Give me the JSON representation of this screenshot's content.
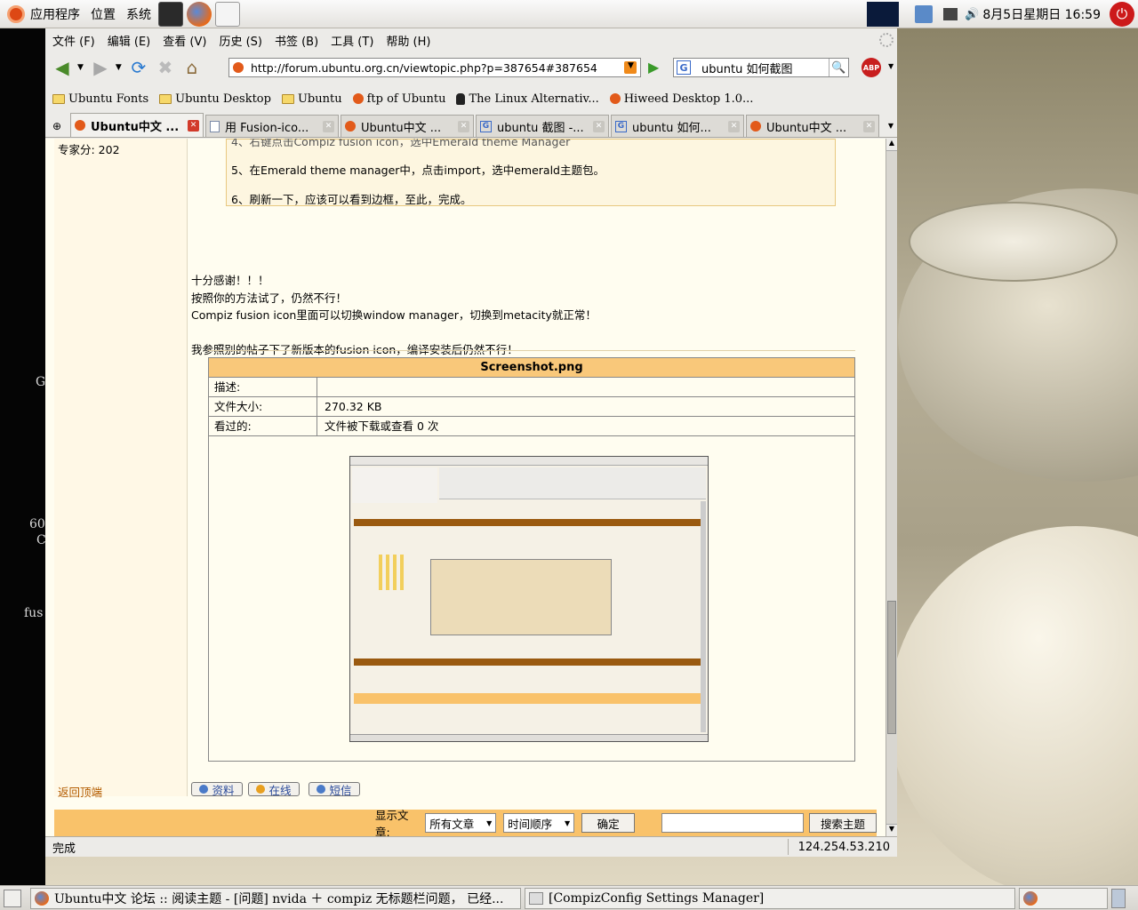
{
  "top_panel": {
    "menus": [
      "应用程序",
      "位置",
      "系统"
    ],
    "clock": "8月5日星期日 16:59"
  },
  "desktop": {
    "texts": [
      "G",
      "60",
      "C",
      "fus"
    ]
  },
  "browser": {
    "menubar": [
      "文件 (F)",
      "编辑 (E)",
      "查看 (V)",
      "历史 (S)",
      "书签 (B)",
      "工具 (T)",
      "帮助 (H)"
    ],
    "url": "http://forum.ubuntu.org.cn/viewtopic.php?p=387654#387654",
    "search_engine": "G",
    "search_value": "ubuntu 如何截图",
    "bookmarks": [
      "Ubuntu Fonts",
      "Ubuntu Desktop",
      "Ubuntu",
      "ftp of Ubuntu",
      "The Linux Alternativ...",
      "Hiweed Desktop 1.0..."
    ],
    "tabs": [
      "Ubuntu中文 ...",
      "用 Fusion-ico...",
      "Ubuntu中文 ...",
      "ubuntu 截图 -...",
      "ubuntu 如何...",
      "Ubuntu中文 ..."
    ],
    "status_left": "完成",
    "status_right": "124.254.53.210"
  },
  "post": {
    "expert_score": "专家分: 202",
    "quote_lines": [
      "4、右键点击Compiz fusion icon，选中Emerald theme Manager",
      "5、在Emerald theme manager中，点击import，选中emerald主题包。",
      "6、刷新一下，应该可以看到边框，至此，完成。"
    ],
    "body_lines": [
      "十分感谢！！！",
      "按照你的方法试了，仍然不行！",
      "Compiz fusion icon里面可以切换window manager，切换到metacity就正常！",
      "",
      "我参照别的帖子下了新版本的fusion icon，编译安装后仍然不行！"
    ],
    "attachment": {
      "title": "Screenshot.png",
      "rows": [
        {
          "label": "描述:",
          "value": ""
        },
        {
          "label": "文件大小:",
          "value": "270.32 KB"
        },
        {
          "label": "看过的:",
          "value": "文件被下载或查看 0 次"
        }
      ]
    },
    "back_to_top": "返回顶端",
    "action_buttons": [
      "资料",
      "在线",
      "短信"
    ]
  },
  "footer": {
    "show_label": "显示文章:",
    "select_posts": "所有文章",
    "select_order": "时间顺序",
    "confirm": "确定",
    "search_topic": "搜索主题"
  },
  "taskbar": {
    "tasks": [
      "Ubuntu中文 论坛 :: 阅读主题 - [问题] nvida ＋ compiz 无标题栏问题， 已经...",
      "[CompizConfig Settings Manager]"
    ]
  }
}
